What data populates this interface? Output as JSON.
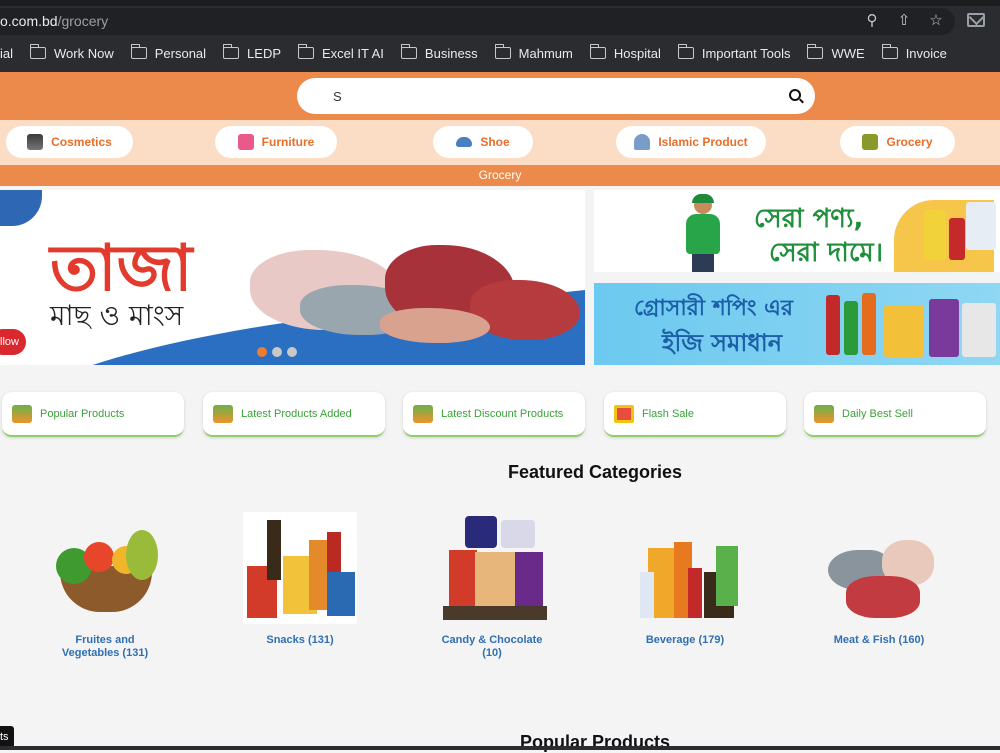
{
  "browser": {
    "url_domain": "o.com.bd",
    "url_path": "/grocery",
    "bookmarks": [
      "ial",
      "Work Now",
      "Personal",
      "LEDP",
      "Excel IT AI",
      "Business",
      "Mahmum",
      "Hospital",
      "Important Tools",
      "WWE",
      "Invoice"
    ]
  },
  "search": {
    "value": "S"
  },
  "categories_nav": [
    {
      "label": "Cosmetics",
      "icon": "cosmetics-icon"
    },
    {
      "label": "Furniture",
      "icon": "furniture-icon"
    },
    {
      "label": "Shoe",
      "icon": "shoe-icon"
    },
    {
      "label": "Islamic Product",
      "icon": "mosque-icon"
    },
    {
      "label": "Grocery",
      "icon": "grocery-basket-icon"
    }
  ],
  "current_section": "Grocery",
  "hero": {
    "title": "তাজা",
    "subtitle": "মাছ ও মাংস",
    "button": "llow"
  },
  "banners": {
    "top_line1": "সেরা পণ্য,",
    "top_line2": "সেরা দামে।",
    "bottom_line1": "গ্রোসারী শপিং এর",
    "bottom_line2": "ইজি সমাধান"
  },
  "quick_links": [
    {
      "label": "Popular Products",
      "icon": "grocery-bag-icon"
    },
    {
      "label": "Latest Products Added",
      "icon": "grocery-bag-icon"
    },
    {
      "label": "Latest Discount Products",
      "icon": "grocery-bag-icon"
    },
    {
      "label": "Flash Sale",
      "icon": "gift-icon"
    },
    {
      "label": "Daily Best Sell",
      "icon": "grocery-bag-icon"
    }
  ],
  "featured": {
    "title": "Featured Categories",
    "items": [
      {
        "line1": "Fruites and",
        "line2": "Vegetables (131)"
      },
      {
        "line1": "Snacks (131)",
        "line2": ""
      },
      {
        "line1": "Candy & Chocolate",
        "line2": "(10)"
      },
      {
        "line1": "Beverage (179)",
        "line2": ""
      },
      {
        "line1": "Meat & Fish (160)",
        "line2": ""
      }
    ]
  },
  "popular_title": "Popular Products",
  "bottom_badge": "ts",
  "colors": {
    "orange": "#ec8a4c",
    "peach": "#fbdcc4",
    "accent_text": "#e86f2a",
    "link_blue": "#2f6fb3",
    "green": "#3aa23a"
  }
}
